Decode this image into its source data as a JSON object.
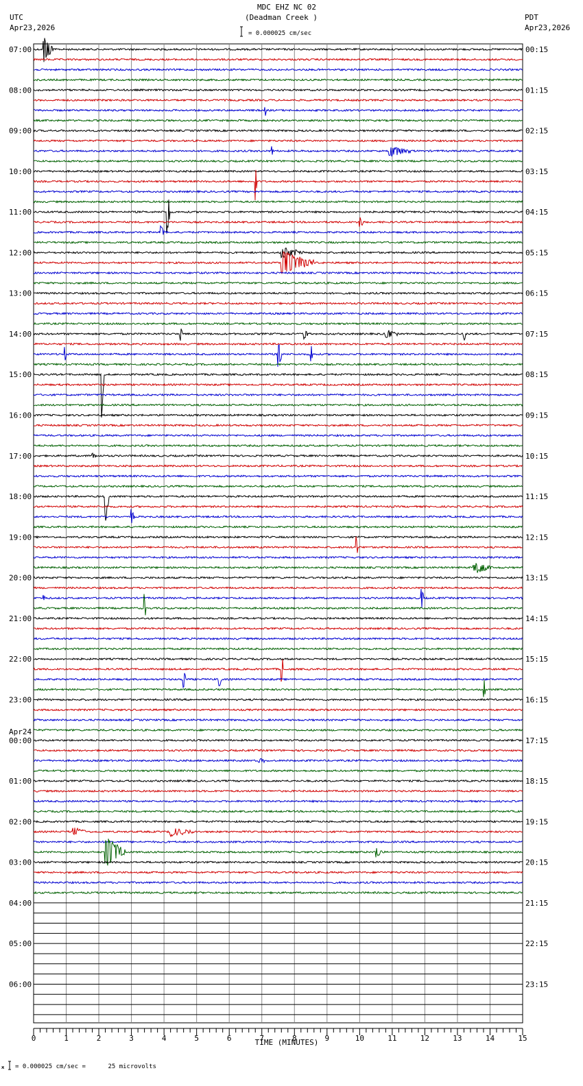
{
  "header": {
    "title": "MDC EHZ NC 02",
    "subtitle": "(Deadman Creek )",
    "left_tz": "UTC",
    "left_date": "Apr23,2026",
    "right_tz": "PDT",
    "right_date": "Apr23,2026",
    "scale_text": "= 0.000025 cm/sec"
  },
  "footer": {
    "scale_text": "= 0.000025 cm/sec =      25 microvolts"
  },
  "chart_data": {
    "type": "line",
    "title": "MDC EHZ NC 02 (Deadman Creek )",
    "xlabel": "TIME (MINUTES)",
    "xlim": [
      0,
      15
    ],
    "x_ticks": [
      "0",
      "1",
      "2",
      "3",
      "4",
      "5",
      "6",
      "7",
      "8",
      "9",
      "10",
      "11",
      "12",
      "13",
      "14",
      "15"
    ],
    "traces_per_hour": 4,
    "total_lines": 96,
    "lines_with_data": 84,
    "trace_colors": [
      "#000000",
      "#d00000",
      "#0000d0",
      "#006000"
    ],
    "left_labels": [
      "07:00",
      "08:00",
      "09:00",
      "10:00",
      "11:00",
      "12:00",
      "13:00",
      "14:00",
      "15:00",
      "16:00",
      "17:00",
      "18:00",
      "19:00",
      "20:00",
      "21:00",
      "22:00",
      "23:00",
      "00:00",
      "01:00",
      "02:00",
      "03:00",
      "04:00",
      "05:00",
      "06:00"
    ],
    "date_change_label": "Apr24",
    "right_labels": [
      "00:15",
      "01:15",
      "02:15",
      "03:15",
      "04:15",
      "05:15",
      "06:15",
      "07:15",
      "08:15",
      "09:15",
      "10:15",
      "11:15",
      "12:15",
      "13:15",
      "14:15",
      "15:15",
      "16:15",
      "17:15",
      "18:15",
      "19:15",
      "20:15",
      "21:15",
      "22:15",
      "23:15"
    ],
    "events": [
      {
        "trace": 0,
        "minute": 0.3,
        "amp": 20,
        "dur": 0.3
      },
      {
        "trace": 6,
        "minute": 7.1,
        "amp": 8,
        "dur": 0.05
      },
      {
        "trace": 10,
        "minute": 7.3,
        "amp": 8,
        "dur": 0.05
      },
      {
        "trace": 10,
        "minute": 10.9,
        "amp": 8,
        "dur": 0.7
      },
      {
        "trace": 13,
        "minute": 6.8,
        "amp": 30,
        "dur": 0.05
      },
      {
        "trace": 16,
        "minute": 4.1,
        "amp": 35,
        "dur": 0.08
      },
      {
        "trace": 17,
        "minute": 10.0,
        "amp": 8,
        "dur": 0.1
      },
      {
        "trace": 18,
        "minute": 3.9,
        "amp": 10,
        "dur": 0.1
      },
      {
        "trace": 20,
        "minute": 7.6,
        "amp": 8,
        "dur": 0.7
      },
      {
        "trace": 21,
        "minute": 7.6,
        "amp": 18,
        "dur": 1.0
      },
      {
        "trace": 28,
        "minute": 4.5,
        "amp": 10,
        "dur": 0.05
      },
      {
        "trace": 28,
        "minute": 8.3,
        "amp": 8,
        "dur": 0.1
      },
      {
        "trace": 28,
        "minute": 10.8,
        "amp": 6,
        "dur": 0.4
      },
      {
        "trace": 28,
        "minute": 13.2,
        "amp": 10,
        "dur": 0.05
      },
      {
        "trace": 30,
        "minute": 0.95,
        "amp": 12,
        "dur": 0.05
      },
      {
        "trace": 30,
        "minute": 7.5,
        "amp": 20,
        "dur": 0.1
      },
      {
        "trace": 30,
        "minute": 8.5,
        "amp": 15,
        "dur": 0.05
      },
      {
        "trace": 32,
        "minute": 2.1,
        "amp": 60,
        "dur": 0.05
      },
      {
        "trace": 40,
        "minute": 1.8,
        "amp": 5,
        "dur": 0.1
      },
      {
        "trace": 44,
        "minute": 2.2,
        "amp": 40,
        "dur": 0.1
      },
      {
        "trace": 46,
        "minute": 3.0,
        "amp": 10,
        "dur": 0.1
      },
      {
        "trace": 49,
        "minute": 9.9,
        "amp": 15,
        "dur": 0.05
      },
      {
        "trace": 51,
        "minute": 13.5,
        "amp": 8,
        "dur": 0.6
      },
      {
        "trace": 54,
        "minute": 0.3,
        "amp": 6,
        "dur": 0.05
      },
      {
        "trace": 54,
        "minute": 11.9,
        "amp": 15,
        "dur": 0.05
      },
      {
        "trace": 55,
        "minute": 3.4,
        "amp": 20,
        "dur": 0.05
      },
      {
        "trace": 61,
        "minute": 7.6,
        "amp": 30,
        "dur": 0.05
      },
      {
        "trace": 62,
        "minute": 4.6,
        "amp": 15,
        "dur": 0.05
      },
      {
        "trace": 62,
        "minute": 5.7,
        "amp": 12,
        "dur": 0.05
      },
      {
        "trace": 63,
        "minute": 13.8,
        "amp": 18,
        "dur": 0.05
      },
      {
        "trace": 70,
        "minute": 6.9,
        "amp": 5,
        "dur": 0.2
      },
      {
        "trace": 77,
        "minute": 1.2,
        "amp": 6,
        "dur": 0.4
      },
      {
        "trace": 77,
        "minute": 4.2,
        "amp": 6,
        "dur": 0.8
      },
      {
        "trace": 79,
        "minute": 2.2,
        "amp": 25,
        "dur": 0.6
      },
      {
        "trace": 79,
        "minute": 10.5,
        "amp": 8,
        "dur": 0.2
      }
    ]
  }
}
